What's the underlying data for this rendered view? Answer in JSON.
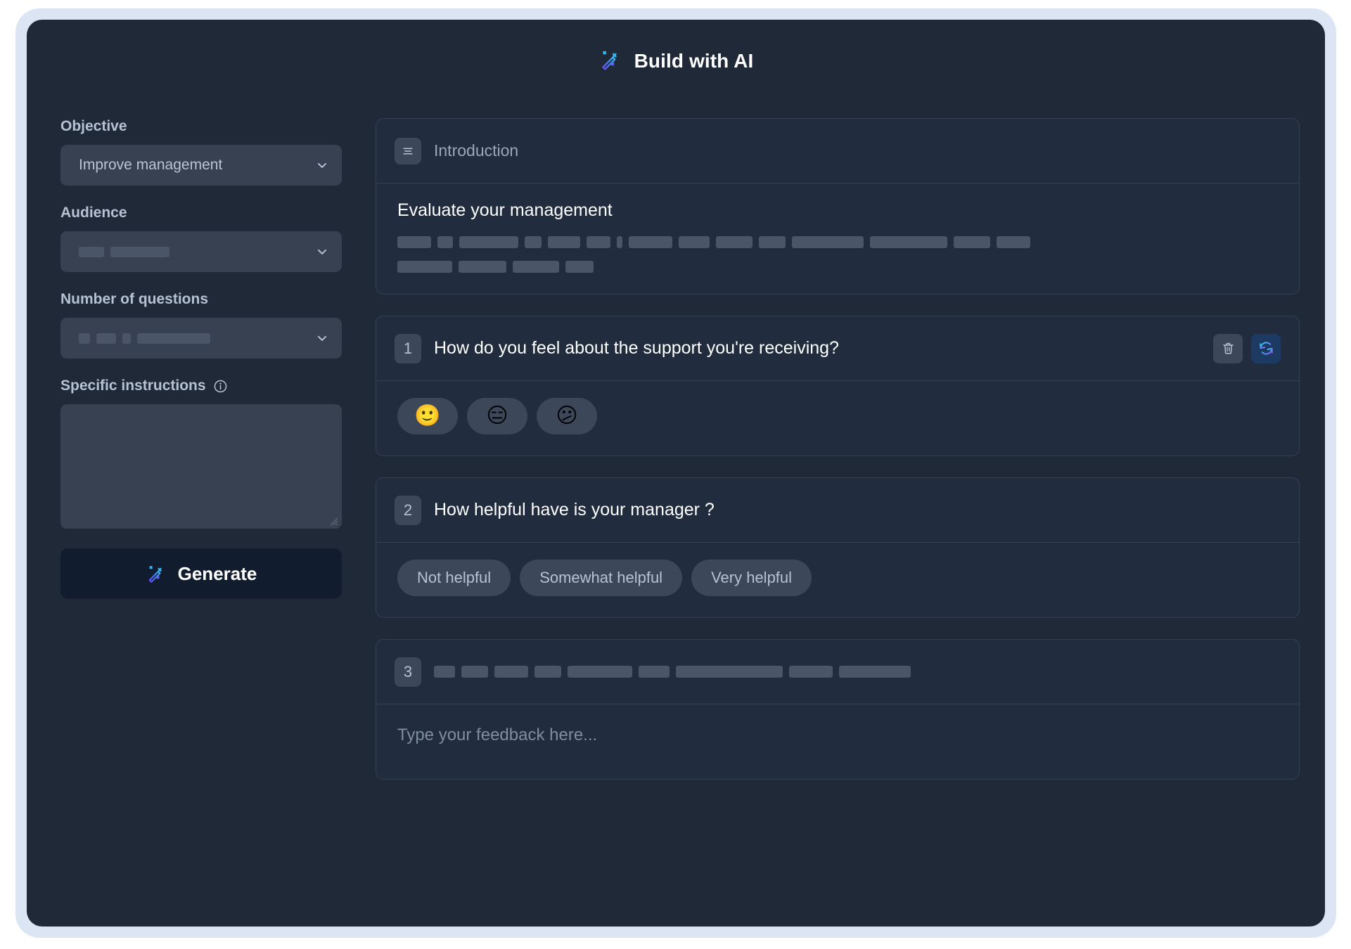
{
  "header": {
    "title": "Build with AI",
    "icon": "magic-wand-icon"
  },
  "sidebar": {
    "objective": {
      "label": "Objective",
      "value": "Improve management",
      "chevron": "chevron-down-icon"
    },
    "audience": {
      "label": "Audience",
      "value": "",
      "placeholder_skeletons": [
        36,
        84
      ],
      "chevron": "chevron-down-icon"
    },
    "number_of_questions": {
      "label": "Number of questions",
      "value": "",
      "placeholder_skeletons": [
        16,
        28,
        12,
        104
      ],
      "chevron": "chevron-down-icon"
    },
    "specific_instructions": {
      "label": "Specific instructions",
      "info_icon": "info-circle-icon",
      "value": "",
      "placeholder": ""
    },
    "generate": {
      "label": "Generate",
      "icon": "magic-wand-icon"
    }
  },
  "preview": {
    "introduction": {
      "icon": "list-lines-icon",
      "header_label": "Introduction",
      "heading": "Evaluate your management",
      "skeleton_rows": [
        [
          48,
          22,
          84,
          24,
          46,
          34,
          8,
          62,
          44,
          52,
          38,
          102,
          110,
          52,
          48
        ],
        [
          78,
          68,
          66,
          40
        ]
      ]
    },
    "questions": [
      {
        "number": "1",
        "text": "How do you feel about the support you're receiving?",
        "is_skeleton": false,
        "skeleton_widths": [],
        "answer_type": "emoji",
        "options": [
          "🙂",
          "😑",
          "😕"
        ],
        "actions": [
          {
            "name": "delete-question-button",
            "icon": "trash-icon",
            "style": "neutral"
          },
          {
            "name": "regenerate-question-button",
            "icon": "refresh-icon",
            "style": "accent"
          }
        ]
      },
      {
        "number": "2",
        "text": "How helpful have is your manager ?",
        "is_skeleton": false,
        "skeleton_widths": [],
        "answer_type": "choices",
        "options": [
          "Not helpful",
          "Somewhat helpful",
          "Very helpful"
        ],
        "actions": []
      },
      {
        "number": "3",
        "text": "",
        "is_skeleton": true,
        "skeleton_widths": [
          30,
          38,
          48,
          38,
          92,
          44,
          152,
          62,
          102
        ],
        "answer_type": "text",
        "options": [],
        "placeholder": "Type your feedback here...",
        "actions": []
      }
    ]
  },
  "colors": {
    "app_background": "#1f2937",
    "frame_border": "#dbe5f3",
    "card_background": "#212d3f",
    "card_border": "#334155",
    "control_background": "#374151",
    "chip_background": "#3c4759",
    "skeleton": "#4a5568",
    "accent_blue": "#3b82f6",
    "accent_cyan": "#22d3ee",
    "accent_purple": "#8b5cf6",
    "text_primary": "#ffffff",
    "text_muted": "#b6c2d4",
    "text_placeholder": "#7f8da1"
  }
}
